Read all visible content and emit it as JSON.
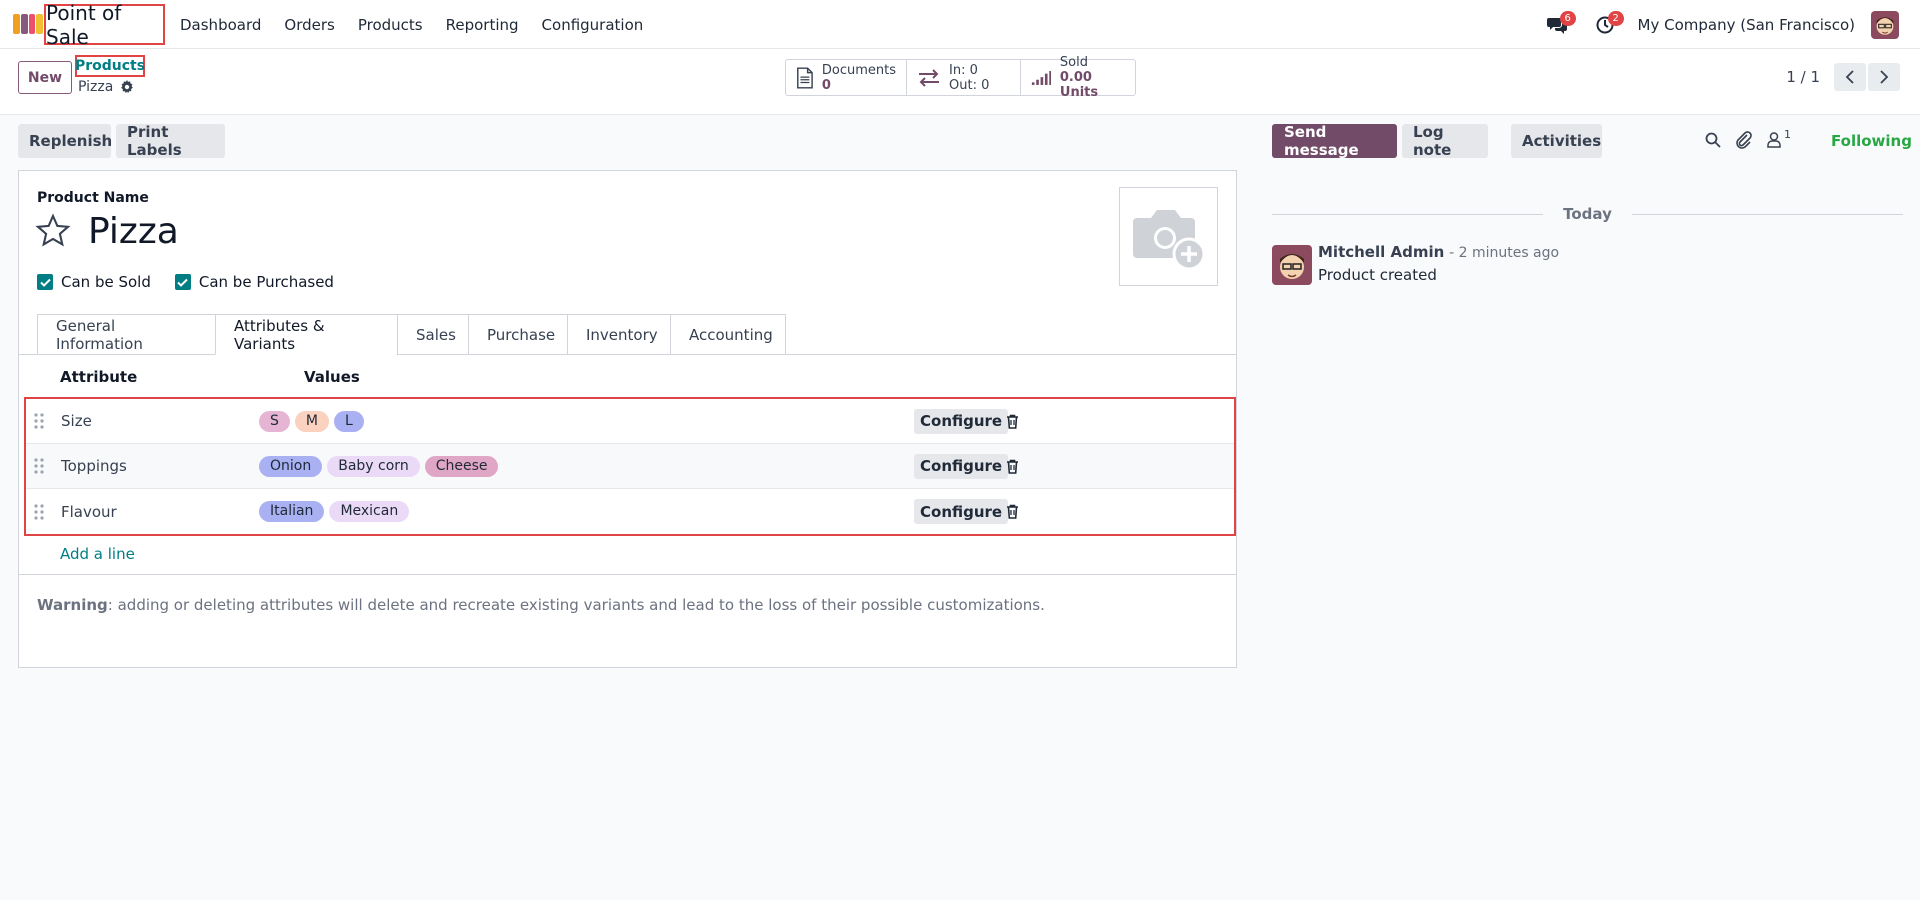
{
  "app": {
    "name": "Point of Sale",
    "logo_colors": [
      "#f0a020",
      "#875a7b",
      "#ef4f6e",
      "#f0c030"
    ]
  },
  "menu": [
    "Dashboard",
    "Orders",
    "Products",
    "Reporting",
    "Configuration"
  ],
  "nav_right": {
    "messages_count": "6",
    "activities_count": "2",
    "company": "My Company (San Francisco)"
  },
  "control": {
    "new_label": "New",
    "breadcrumb_parent": "Products",
    "breadcrumb_current": "Pizza",
    "pager": "1 / 1"
  },
  "smart_buttons": {
    "documents_label": "Documents",
    "documents_value": "0",
    "in_label": "In:",
    "in_value": "0",
    "out_label": "Out:",
    "out_value": "0",
    "sold_label": "Sold",
    "sold_value": "0.00 Units"
  },
  "actions": {
    "replenish": "Replenish",
    "print_labels": "Print Labels"
  },
  "form": {
    "product_name_label": "Product Name",
    "product_name": "Pizza",
    "can_be_sold": "Can be Sold",
    "can_be_purchased": "Can be Purchased",
    "tabs": [
      "General Information",
      "Attributes & Variants",
      "Sales",
      "Purchase",
      "Inventory",
      "Accounting"
    ],
    "active_tab": "Attributes & Variants",
    "table_headers": {
      "attribute": "Attribute",
      "values": "Values"
    },
    "configure_label": "Configure",
    "rows": [
      {
        "attribute": "Size",
        "values": [
          {
            "label": "S",
            "color": "#e6b5d3"
          },
          {
            "label": "M",
            "color": "#fad2bf"
          },
          {
            "label": "L",
            "color": "#a9b1f2"
          }
        ]
      },
      {
        "attribute": "Toppings",
        "values": [
          {
            "label": "Onion",
            "color": "#a9b1f2"
          },
          {
            "label": "Baby corn",
            "color": "#ead9f7"
          },
          {
            "label": "Cheese",
            "color": "#e0a6c5"
          }
        ]
      },
      {
        "attribute": "Flavour",
        "values": [
          {
            "label": "Italian",
            "color": "#a9b1f2"
          },
          {
            "label": "Mexican",
            "color": "#ead9f7"
          }
        ]
      }
    ],
    "add_line": "Add a line",
    "warning_bold": "Warning",
    "warning_text": ": adding or deleting attributes will delete and recreate existing variants and lead to the loss of their possible customizations."
  },
  "chatter": {
    "send_message": "Send message",
    "log_note": "Log note",
    "activities": "Activities",
    "followers_count": "1",
    "following": "Following",
    "day": "Today",
    "author": "Mitchell Admin",
    "time": "- 2 minutes ago",
    "body": "Product created"
  }
}
